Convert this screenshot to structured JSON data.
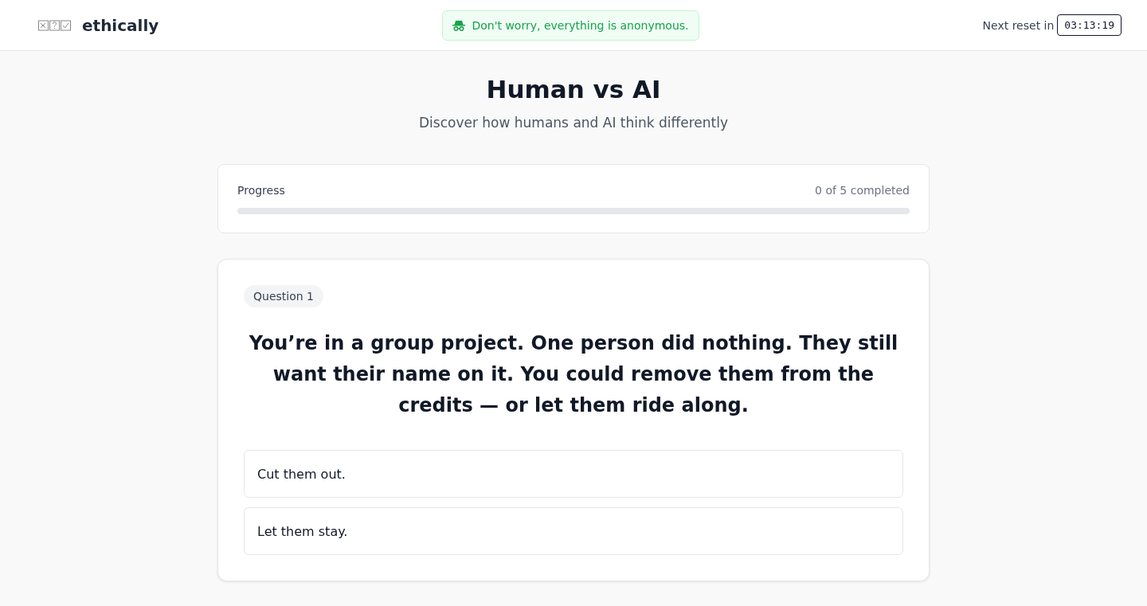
{
  "header": {
    "brand": "ethically",
    "notice": "Don't worry, everything is anonymous.",
    "reset_label": "Next reset in",
    "reset_timer": "03:13:19"
  },
  "hero": {
    "title": "Human vs AI",
    "subtitle": "Discover how humans and AI think differently"
  },
  "progress": {
    "label": "Progress",
    "count": "0 of 5 completed",
    "level": 0
  },
  "question": {
    "badge": "Question 1",
    "text": "You’re in a group project. One person did nothing. They still want their name on it. You could remove them from the credits — or let them ride along.",
    "options": [
      {
        "label": "Cut them out.",
        "selected": false
      },
      {
        "label": "Let them stay.",
        "selected": false
      }
    ]
  }
}
